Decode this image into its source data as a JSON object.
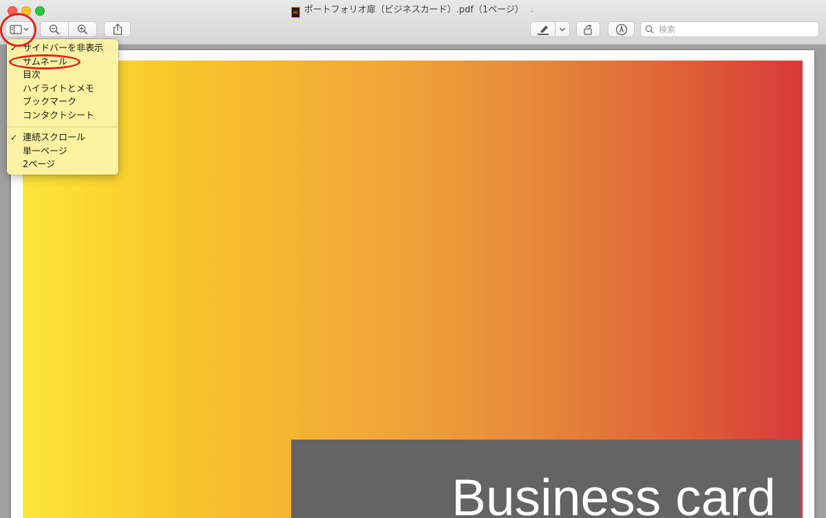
{
  "window": {
    "title": "ポートフォリオ扉（ビジネスカード）.pdf（1ページ）",
    "file_icon_text": "Ai"
  },
  "toolbar": {
    "sidebar_button": "sidebar-toggle",
    "zoom_out": "zoom-out",
    "zoom_in": "zoom-in",
    "share": "share",
    "markup": "highlight",
    "rotate": "rotate",
    "annotate": "markup"
  },
  "search": {
    "placeholder": "検索"
  },
  "menu": {
    "items": [
      {
        "label": "サイドバーを非表示",
        "checked": true
      },
      {
        "label": "サムネール",
        "checked": false
      },
      {
        "label": "目次",
        "checked": false
      },
      {
        "label": "ハイライトとメモ",
        "checked": false
      },
      {
        "label": "ブックマーク",
        "checked": false
      },
      {
        "label": "コンタクトシート",
        "checked": false
      }
    ],
    "items2": [
      {
        "label": "連続スクロール",
        "checked": true
      },
      {
        "label": "単一ページ",
        "checked": false
      },
      {
        "label": "2ページ",
        "checked": false
      }
    ],
    "check_glyph": "✓"
  },
  "document": {
    "banner_text": "Business card"
  },
  "colors": {
    "annotation": "#e3221b",
    "gradient_start": "#fde63a",
    "gradient_end": "#d6393a",
    "banner": "#646464"
  }
}
